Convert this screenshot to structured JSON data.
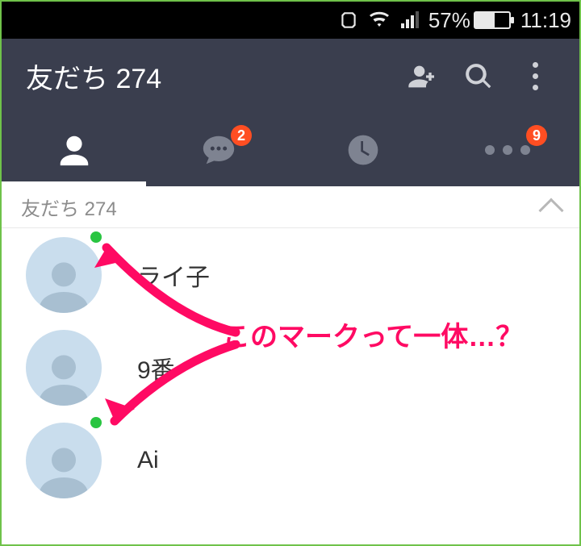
{
  "status": {
    "battery_pct": "57%",
    "time": "11:19",
    "battery_fill_pct": 57
  },
  "header": {
    "title": "友だち 274"
  },
  "tabs": {
    "chats_badge": "2",
    "more_badge": "9"
  },
  "section": {
    "label": "友だち 274"
  },
  "friends": [
    {
      "name": "ライ子",
      "presence": true
    },
    {
      "name": "9番",
      "presence": false
    },
    {
      "name": "Ai",
      "presence": true
    }
  ],
  "annotation": {
    "text": "このマークって一体…？"
  }
}
